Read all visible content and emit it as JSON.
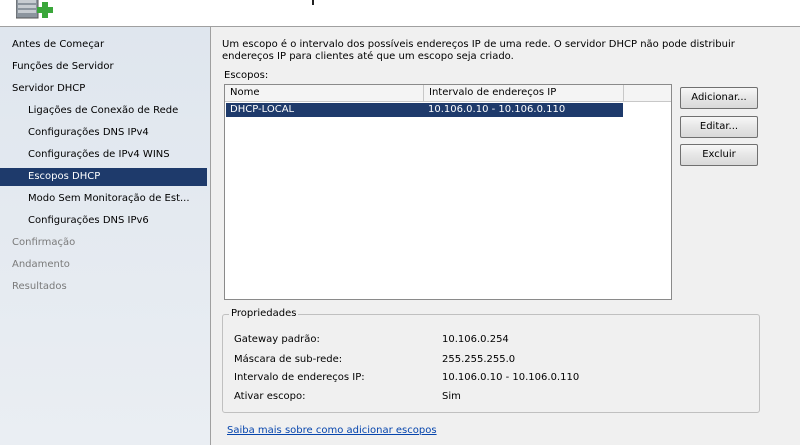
{
  "nav": {
    "items": [
      {
        "label": "Antes de Começar",
        "level": 0,
        "state": "normal"
      },
      {
        "label": "Funções de Servidor",
        "level": 0,
        "state": "normal"
      },
      {
        "label": "Servidor DHCP",
        "level": 0,
        "state": "normal"
      },
      {
        "label": "Ligações de Conexão de Rede",
        "level": 1,
        "state": "normal"
      },
      {
        "label": "Configurações DNS IPv4",
        "level": 1,
        "state": "normal"
      },
      {
        "label": "Configurações de IPv4 WINS",
        "level": 1,
        "state": "normal"
      },
      {
        "label": "Escopos DHCP",
        "level": 1,
        "state": "selected"
      },
      {
        "label": "Modo Sem Monitoração de Est...",
        "level": 1,
        "state": "normal"
      },
      {
        "label": "Configurações DNS IPv6",
        "level": 1,
        "state": "normal"
      },
      {
        "label": "Confirmação",
        "level": 0,
        "state": "disabled"
      },
      {
        "label": "Andamento",
        "level": 0,
        "state": "disabled"
      },
      {
        "label": "Resultados",
        "level": 0,
        "state": "disabled"
      }
    ]
  },
  "main": {
    "description": "Um escopo é o intervalo dos possíveis endereços IP de uma rede. O servidor DHCP não pode distribuir endereços IP para clientes até que um escopo seja criado.",
    "scopes_label": "Escopos:",
    "columns": [
      "Nome",
      "Intervalo de endereços IP"
    ],
    "rows": [
      {
        "name": "DHCP-LOCAL",
        "range": "10.106.0.10 - 10.106.0.110",
        "selected": true
      }
    ],
    "buttons": {
      "add": "Adicionar...",
      "edit": "Editar...",
      "remove": "Excluir"
    },
    "properties": {
      "title": "Propriedades",
      "items": [
        {
          "key": "Gateway padrão:",
          "value": "10.106.0.254"
        },
        {
          "key": "Máscara de sub-rede:",
          "value": "255.255.255.0"
        },
        {
          "key": "Intervalo de endereços IP:",
          "value": "10.106.0.10 - 10.106.0.110"
        },
        {
          "key": "Ativar escopo:",
          "value": "Sim"
        }
      ]
    },
    "help_link": "Saiba mais sobre como adicionar escopos"
  },
  "colors": {
    "selection": "#1e3a6b",
    "link": "#0645ad",
    "accent_green": "#3aa63a"
  },
  "icons": {
    "header": "server-add-icon"
  }
}
